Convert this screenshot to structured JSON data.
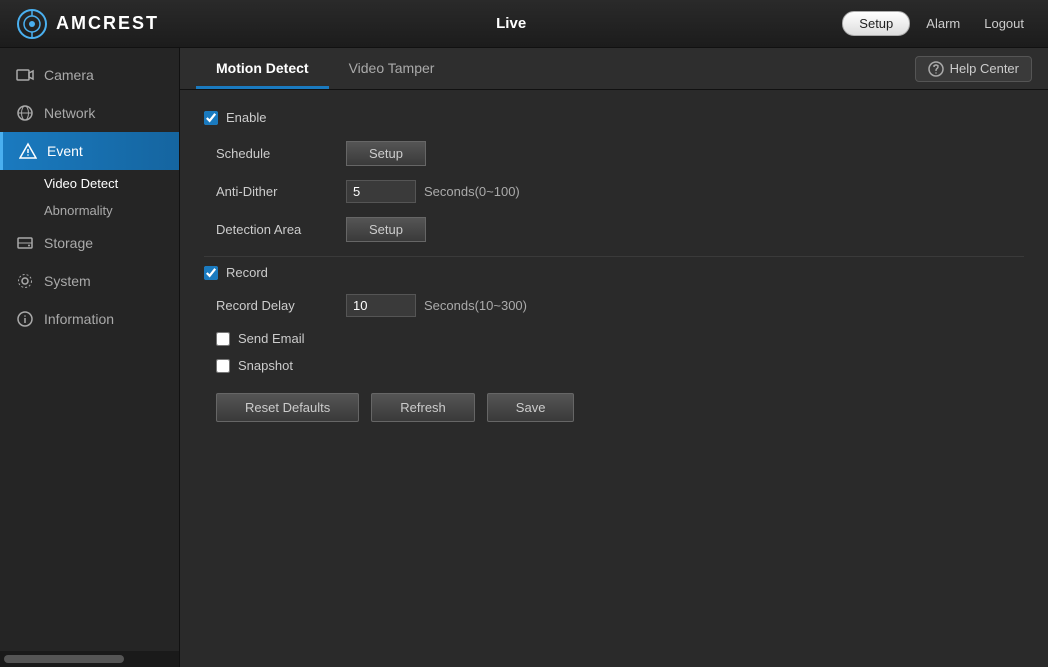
{
  "header": {
    "logo_text": "AMCREST",
    "nav_live": "Live",
    "nav_setup": "Setup",
    "nav_alarm": "Alarm",
    "nav_logout": "Logout"
  },
  "sidebar": {
    "items": [
      {
        "id": "camera",
        "label": "Camera",
        "icon": "camera"
      },
      {
        "id": "network",
        "label": "Network",
        "icon": "network"
      },
      {
        "id": "event",
        "label": "Event",
        "icon": "event",
        "active": true
      },
      {
        "id": "storage",
        "label": "Storage",
        "icon": "storage"
      },
      {
        "id": "system",
        "label": "System",
        "icon": "system"
      },
      {
        "id": "information",
        "label": "Information",
        "icon": "information"
      }
    ],
    "sub_items": [
      {
        "id": "video-detect",
        "label": "Video Detect",
        "active": true
      },
      {
        "id": "abnormality",
        "label": "Abnormality",
        "active": false
      }
    ]
  },
  "tabs": [
    {
      "id": "motion-detect",
      "label": "Motion Detect",
      "active": true
    },
    {
      "id": "video-tamper",
      "label": "Video Tamper",
      "active": false
    }
  ],
  "help_center": "Help Center",
  "form": {
    "enable_label": "Enable",
    "enable_checked": true,
    "schedule_label": "Schedule",
    "schedule_btn": "Setup",
    "anti_dither_label": "Anti-Dither",
    "anti_dither_value": "5",
    "anti_dither_hint": "Seconds(0~100)",
    "detection_area_label": "Detection Area",
    "detection_area_btn": "Setup",
    "record_label": "Record",
    "record_checked": true,
    "record_delay_label": "Record Delay",
    "record_delay_value": "10",
    "record_delay_hint": "Seconds(10~300)",
    "send_email_label": "Send Email",
    "send_email_checked": false,
    "snapshot_label": "Snapshot",
    "snapshot_checked": false
  },
  "buttons": {
    "reset_defaults": "Reset Defaults",
    "refresh": "Refresh",
    "save": "Save"
  }
}
